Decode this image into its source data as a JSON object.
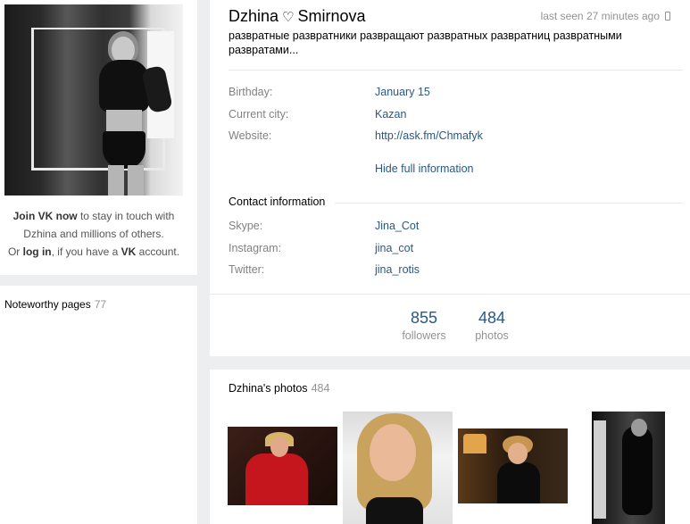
{
  "profile": {
    "first_name": "Dzhina",
    "heart": "♡",
    "last_name": "Smirnova",
    "last_seen": "last seen 27 minutes ago",
    "status": "развратные развратники развращают развратных развратниц развратными развратами..."
  },
  "info": {
    "birthday_label": "Birthday:",
    "birthday_value": "January 15",
    "city_label": "Current city:",
    "city_value": "Kazan",
    "website_label": "Website:",
    "website_value": "http://ask.fm/Chmafyk",
    "hide_link": "Hide full information"
  },
  "contact": {
    "title": "Contact information",
    "skype_label": "Skype:",
    "skype_value": "Jina_Cot",
    "instagram_label": "Instagram:",
    "instagram_value": "jina_cot",
    "twitter_label": "Twitter:",
    "twitter_value": "jina_rotis"
  },
  "stats": {
    "followers_count": "855",
    "followers_label": "followers",
    "photos_count": "484",
    "photos_label": "photos"
  },
  "join": {
    "join_vk_now": "Join VK now",
    "text1": " to stay in touch with Dzhina and millions of others.",
    "or": "Or ",
    "log_in": "log in",
    "text2": ", if you have a ",
    "vk": "VK",
    "text3": " account."
  },
  "noteworthy": {
    "label": "Noteworthy pages",
    "count": "77"
  },
  "photos_section": {
    "title": "Dzhina's photos",
    "count": "484"
  },
  "colors": {
    "link": "#2a5885",
    "muted": "#939393",
    "label": "#828282",
    "background": "#edeef0"
  },
  "icons": {
    "phone": "mobile-phone-icon"
  }
}
